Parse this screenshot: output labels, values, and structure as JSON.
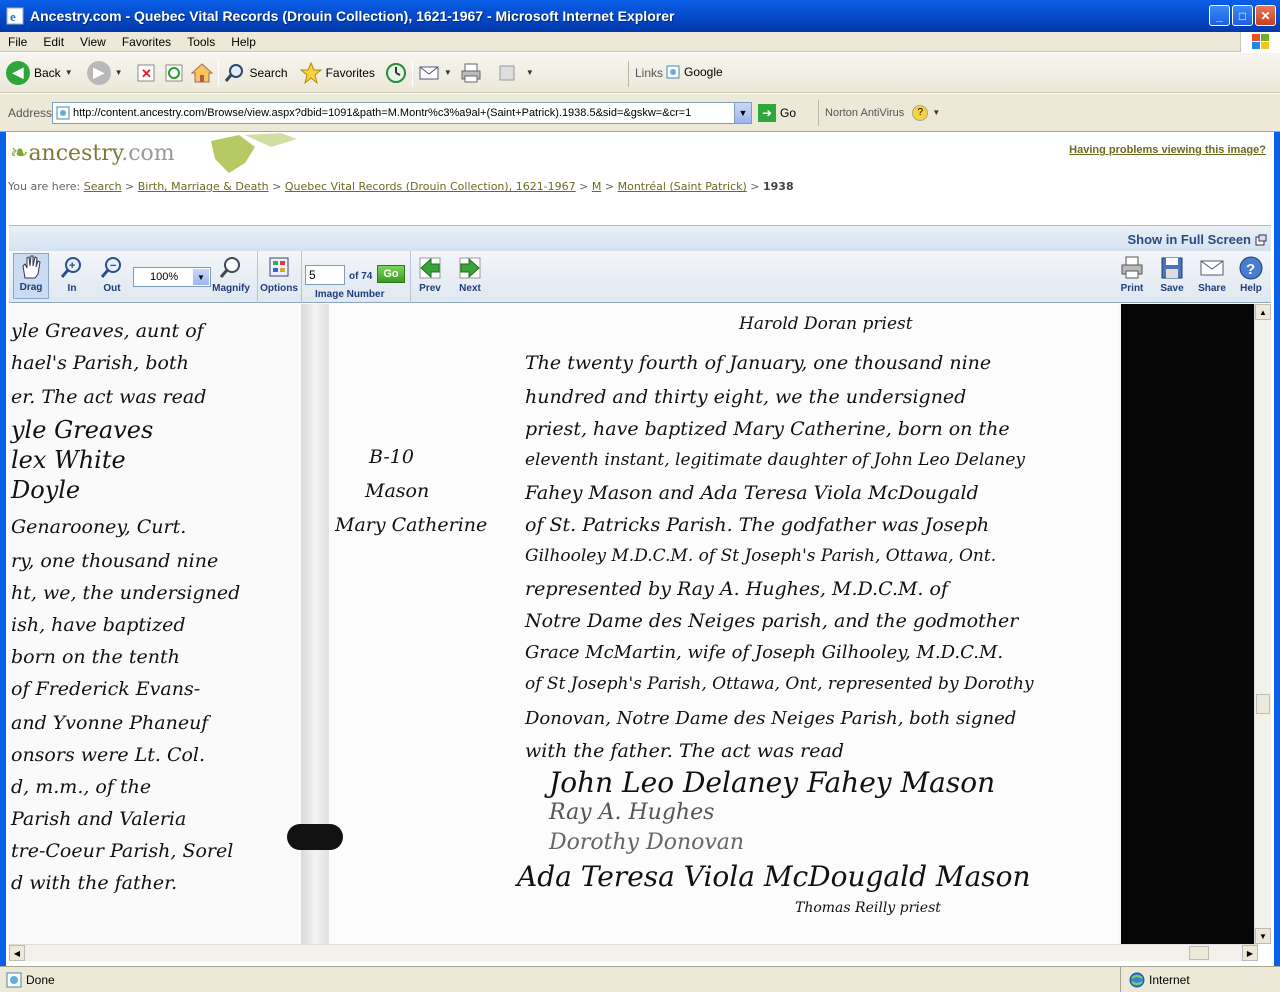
{
  "window": {
    "title": "Ancestry.com - Quebec Vital Records (Drouin Collection), 1621-1967 - Microsoft Internet Explorer",
    "minimize": "_",
    "maximize": "□",
    "close": "✕"
  },
  "menu": [
    "File",
    "Edit",
    "View",
    "Favorites",
    "Tools",
    "Help"
  ],
  "toolbar": {
    "back": "Back",
    "search": "Search",
    "favorites": "Favorites",
    "links": "Links",
    "google": "Google"
  },
  "address": {
    "label": "Address",
    "url": "http://content.ancestry.com/Browse/view.aspx?dbid=1091&path=M.Montr%c3%a9al+(Saint+Patrick).1938.5&sid=&gskw=&cr=1",
    "go": "Go",
    "norton": "Norton AntiVirus"
  },
  "site": {
    "logo_prefix": "ancestry",
    "logo_suffix": ".com",
    "problem_link": "Having problems viewing this image?",
    "you_are_here": "You are here:",
    "breadcrumb": [
      "Search",
      "Birth, Marriage & Death",
      "Quebec Vital Records (Drouin Collection), 1621-1967",
      "M",
      "Montréal (Saint Patrick)"
    ],
    "breadcrumb_current": "1938",
    "fullscreen": "Show in Full Screen"
  },
  "viewer": {
    "drag": "Drag",
    "zoom_in": "In",
    "zoom_out": "Out",
    "zoom_value": "100%",
    "magnify": "Magnify",
    "options": "Options",
    "image_number_value": "5",
    "of_total": "of 74",
    "go": "Go",
    "image_number": "Image Number",
    "prev": "Prev",
    "next": "Next",
    "print": "Print",
    "save": "Save",
    "share": "Share",
    "help": "Help"
  },
  "document": {
    "left_col": [
      "yle Greaves, aunt of",
      "hael's Parish, both",
      "er. The act was read",
      "yle Greaves",
      "lex White",
      "Doyle",
      "Genarooney, Curt.",
      "ry, one thousand nine",
      "ht, we, the undersigned",
      "ish, have baptized",
      "born on the tenth",
      "of Frederick Evans-",
      "and Yvonne Phaneuf",
      "onsors were Lt. Col.",
      "d, m.m., of the",
      "Parish and Valeria",
      "tre-Coeur Parish, Sorel",
      "d with the father."
    ],
    "margin": [
      "B-10",
      "Mason",
      "Mary Catherine"
    ],
    "right_col": [
      "Harold Doran priest",
      "The twenty fourth of January, one thousand nine",
      "hundred and thirty eight, we the undersigned",
      "priest, have baptized Mary Catherine, born on the",
      "eleventh instant, legitimate daughter of John Leo Delaney",
      "Fahey Mason and Ada Teresa Viola McDougald",
      "of St. Patricks Parish. The godfather was Joseph",
      "Gilhooley M.D.C.M. of St Joseph's Parish, Ottawa, Ont.",
      "represented by Ray A. Hughes, M.D.C.M. of",
      "Notre Dame des Neiges parish, and the godmother",
      "Grace McMartin, wife of Joseph Gilhooley, M.D.C.M.",
      "of St Joseph's Parish, Ottawa, Ont, represented by Dorothy",
      "Donovan, Notre Dame des Neiges Parish, both signed",
      "with the father. The act was read"
    ],
    "signatures": [
      "John Leo Delaney Fahey Mason",
      "Ray A. Hughes",
      "Dorothy Donovan",
      "Ada Teresa Viola McDougald Mason",
      "Thomas Reilly priest"
    ]
  },
  "status": {
    "text": "Done",
    "zone": "Internet"
  }
}
